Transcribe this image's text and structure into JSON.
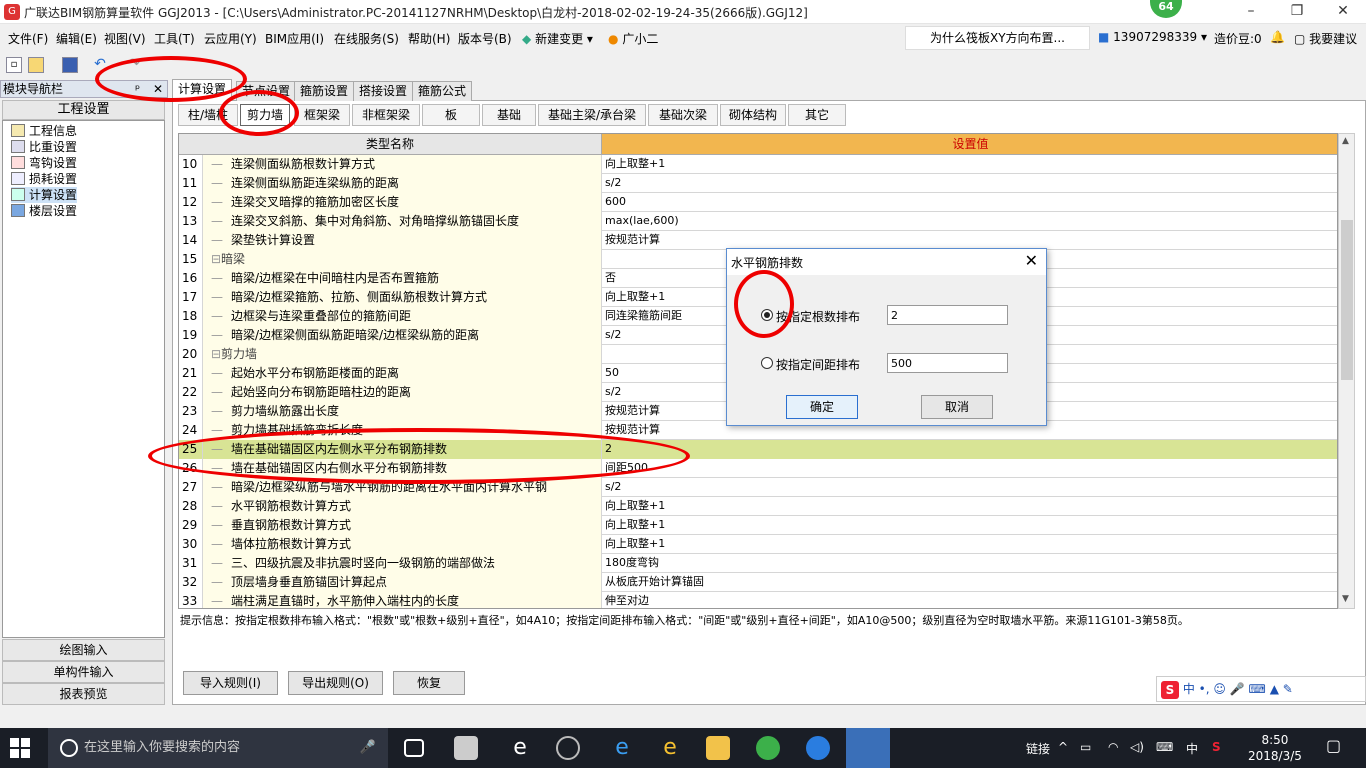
{
  "window": {
    "title": "广联达BIM钢筋算量软件 GGJ2013 - [C:\\Users\\Administrator.PC-20141127NRHM\\Desktop\\白龙村-2018-02-02-19-24-35(2666版).GGJ12]",
    "badge": "64",
    "min": "–",
    "max": "❐",
    "close": "✕"
  },
  "menu": {
    "items": [
      "文件(F)",
      "编辑(E)",
      "视图(V)",
      "工具(T)",
      "云应用(Y)",
      "BIM应用(I)",
      "在线服务(S)",
      "帮助(H)",
      "版本号(B)",
      "新建变更",
      "广小二"
    ],
    "hint": "为什么筏板XY方向布置...",
    "phone": "13907298339",
    "bean": "造价豆:0",
    "suggest": "我要建议"
  },
  "nav": {
    "title": "模块导航栏",
    "pin": "ᵖ",
    "close": "✕",
    "section": "工程设置",
    "items": [
      "工程信息",
      "比重设置",
      "弯钩设置",
      "损耗设置",
      "计算设置",
      "楼层设置"
    ],
    "bottom": [
      "绘图输入",
      "单构件输入",
      "报表预览"
    ]
  },
  "tabs": {
    "top": [
      "计算设置",
      "节点设置",
      "箍筋设置",
      "搭接设置",
      "箍筋公式"
    ],
    "sub": [
      "柱/墙柱",
      "剪力墙",
      "框架梁",
      "非框架梁",
      "板",
      "基础",
      "基础主梁/承台梁",
      "基础次梁",
      "砌体结构",
      "其它"
    ]
  },
  "grid": {
    "col1": "类型名称",
    "col2": "设置值",
    "rows": [
      {
        "n": "10",
        "name": "连梁侧面纵筋根数计算方式",
        "val": "向上取整+1"
      },
      {
        "n": "11",
        "name": "连梁侧面纵筋距连梁纵筋的距离",
        "val": "s/2"
      },
      {
        "n": "12",
        "name": "连梁交叉暗撑的箍筋加密区长度",
        "val": "600"
      },
      {
        "n": "13",
        "name": "连梁交叉斜筋、集中对角斜筋、对角暗撑纵筋锚固长度",
        "val": "max(lae,600)"
      },
      {
        "n": "14",
        "name": "梁垫铁计算设置",
        "val": "按规范计算"
      },
      {
        "n": "15",
        "name": "暗梁",
        "val": "",
        "group": true
      },
      {
        "n": "16",
        "name": "暗梁/边框梁在中间暗柱内是否布置箍筋",
        "val": "否"
      },
      {
        "n": "17",
        "name": "暗梁/边框梁箍筋、拉筋、侧面纵筋根数计算方式",
        "val": "向上取整+1"
      },
      {
        "n": "18",
        "name": "边框梁与连梁重叠部位的箍筋间距",
        "val": "同连梁箍筋间距"
      },
      {
        "n": "19",
        "name": "暗梁/边框梁侧面纵筋距暗梁/边框梁纵筋的距离",
        "val": "s/2"
      },
      {
        "n": "20",
        "name": "剪力墙",
        "val": "",
        "group": true
      },
      {
        "n": "21",
        "name": "起始水平分布钢筋距楼面的距离",
        "val": "50"
      },
      {
        "n": "22",
        "name": "起始竖向分布钢筋距暗柱边的距离",
        "val": "s/2"
      },
      {
        "n": "23",
        "name": "剪力墙纵筋露出长度",
        "val": "按规范计算"
      },
      {
        "n": "24",
        "name": "剪力墙基础插筋弯折长度",
        "val": "按规范计算"
      },
      {
        "n": "25",
        "name": "墙在基础锚固区内左侧水平分布钢筋排数",
        "val": "2",
        "hl": true
      },
      {
        "n": "26",
        "name": "墙在基础锚固区内右侧水平分布钢筋排数",
        "val": "间距500"
      },
      {
        "n": "27",
        "name": "暗梁/边框梁纵筋与墙水平钢筋的距离在水平面内计算水平钢",
        "val": "s/2"
      },
      {
        "n": "28",
        "name": "水平钢筋根数计算方式",
        "val": "向上取整+1"
      },
      {
        "n": "29",
        "name": "垂直钢筋根数计算方式",
        "val": "向上取整+1"
      },
      {
        "n": "30",
        "name": "墙体拉筋根数计算方式",
        "val": "向上取整+1"
      },
      {
        "n": "31",
        "name": "三、四级抗震及非抗震时竖向一级钢筋的端部做法",
        "val": "180度弯钩"
      },
      {
        "n": "32",
        "name": "顶层墙身垂直筋锚固计算起点",
        "val": "从板底开始计算锚固"
      },
      {
        "n": "33",
        "name": "端柱满足直锚时，水平筋伸入端柱内的长度",
        "val": "伸至对边"
      }
    ]
  },
  "hint_line": "提示信息：按指定根数排布输入格式：\"根数\"或\"根数+级别+直径\"，如4A10；按指定间距排布输入格式：\"间距\"或\"级别+直径+间距\"，如A10@500；级别直径为空时取墙水平筋。来源11G101-3第58页。",
  "buttons": {
    "import": "导入规则(I)",
    "export": "导出规则(O)",
    "restore": "恢复"
  },
  "dialog": {
    "title": "水平钢筋排数",
    "close": "✕",
    "opt1": "按指定根数排布",
    "opt1_value": "2",
    "opt2": "按指定间距排布",
    "opt2_value": "500",
    "ok": "确定",
    "cancel": "取消"
  },
  "taskbar": {
    "search": "在这里输入你要搜索的内容",
    "link": "链接",
    "lang": "中",
    "time": "8:50",
    "date": "2018/3/5"
  },
  "ime": {
    "cn": "中",
    "punct": "•,"
  }
}
